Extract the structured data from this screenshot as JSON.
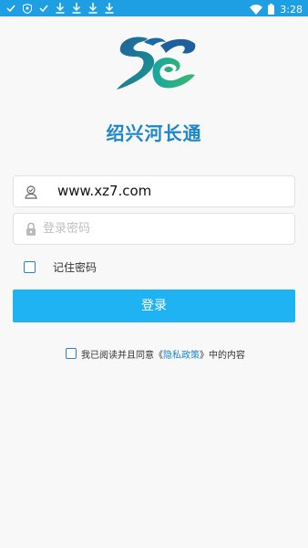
{
  "status_bar": {
    "time": "3:28",
    "left_icons": [
      "check-icon",
      "shield-icon",
      "check-icon",
      "download-icon",
      "download-icon",
      "download-icon",
      "download-icon"
    ],
    "right_icons": [
      "wifi-icon",
      "battery-icon"
    ]
  },
  "app": {
    "title": "绍兴河长通"
  },
  "login_form": {
    "username_value": "www.xz7.com",
    "password_placeholder": "登录密码",
    "remember_label": "记住密码",
    "login_button": "登录"
  },
  "agreement": {
    "prefix": "我已阅读并且同意",
    "open_quote": "《",
    "link_text": "隐私政策",
    "close_quote": "》",
    "suffix": "中的内容"
  },
  "colors": {
    "status_bar": "#1e9fe4",
    "accent": "#1fb3f3",
    "title": "#1b86c9",
    "background": "#f8f8f8"
  }
}
